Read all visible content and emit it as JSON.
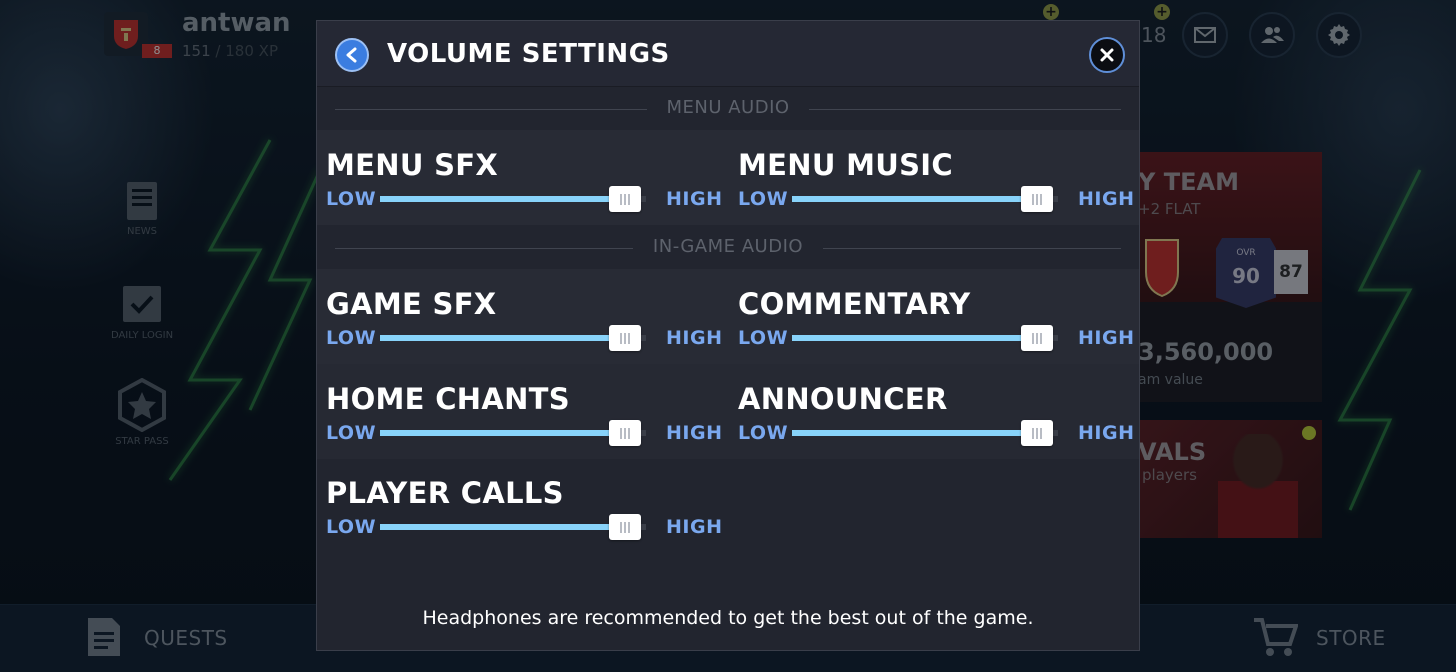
{
  "background": {
    "username": "antwan",
    "level": "8",
    "xp_current": "151",
    "xp_max": "180 XP",
    "currency_partial": "18",
    "sidebar": [
      "NEWS",
      "DAILY LOGIN",
      "STAR PASS"
    ],
    "card_team_title": "Y TEAM",
    "card_team_sub": "+2 FLAT",
    "card_ovr_label": "OVR",
    "card_ovr": "90",
    "card_ovr2": "87",
    "card_team_value": "3,560,000",
    "card_team_value_label": "am value",
    "card_rivals_title": "VALS",
    "card_rivals_sub": "players",
    "bottom_left": "QUESTS",
    "bottom_right": "STORE"
  },
  "modal": {
    "title": "VOLUME SETTINGS",
    "footer": "Headphones are recommended to get the best out of the game.",
    "low_label": "LOW",
    "high_label": "HIGH",
    "sections": [
      {
        "label": "MENU AUDIO",
        "sliders": [
          {
            "name": "MENU SFX",
            "value": 0.92
          },
          {
            "name": "MENU MUSIC",
            "value": 0.92
          }
        ]
      },
      {
        "label": "IN-GAME AUDIO",
        "sliders": [
          {
            "name": "GAME SFX",
            "value": 0.92
          },
          {
            "name": "COMMENTARY",
            "value": 0.92
          },
          {
            "name": "HOME CHANTS",
            "value": 0.92
          },
          {
            "name": "ANNOUNCER",
            "value": 0.92
          },
          {
            "name": "PLAYER CALLS",
            "value": 0.92
          }
        ]
      }
    ]
  },
  "colors": {
    "accent_blue": "#3b7de0",
    "slider_fill": "#88d3fa",
    "low_high_text": "#7aa8ef",
    "modal_bg": "#22252f"
  }
}
